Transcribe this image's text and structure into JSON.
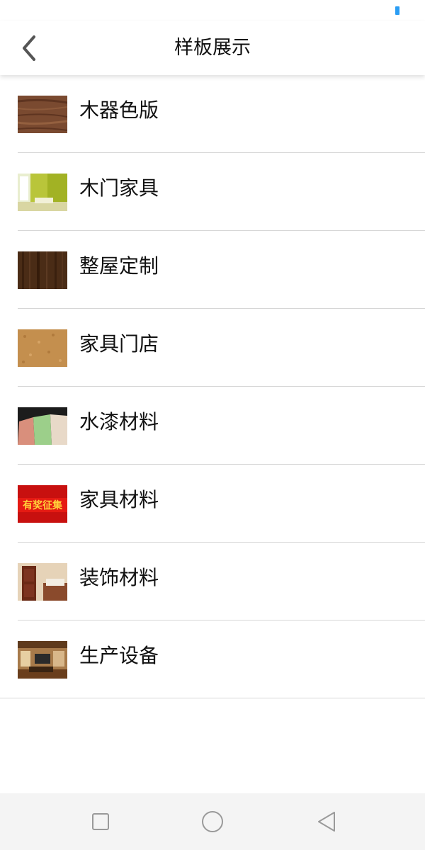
{
  "header": {
    "title": "样板展示",
    "back_icon": "chevron-left-icon"
  },
  "list": {
    "items": [
      {
        "label": "木器色版",
        "thumb": "wood-grain-sample"
      },
      {
        "label": "木门家具",
        "thumb": "green-room-interior"
      },
      {
        "label": "整屋定制",
        "thumb": "dark-wood-panel"
      },
      {
        "label": "家具门店",
        "thumb": "tan-texture-sample"
      },
      {
        "label": "水漆材料",
        "thumb": "paint-color-panels"
      },
      {
        "label": "家具材料",
        "thumb": "red-award-banner"
      },
      {
        "label": "装饰材料",
        "thumb": "wooden-door-bedroom"
      },
      {
        "label": "生产设备",
        "thumb": "living-room-interior"
      }
    ]
  },
  "thumb_banner_text": "有奖征集",
  "navbar": {
    "recent_icon": "square-icon",
    "home_icon": "circle-icon",
    "back_icon": "triangle-back-icon"
  },
  "colors": {
    "status_indicator": "#2a9df4",
    "divider": "#d6d6d6",
    "navbar_bg": "#f4f4f4"
  }
}
